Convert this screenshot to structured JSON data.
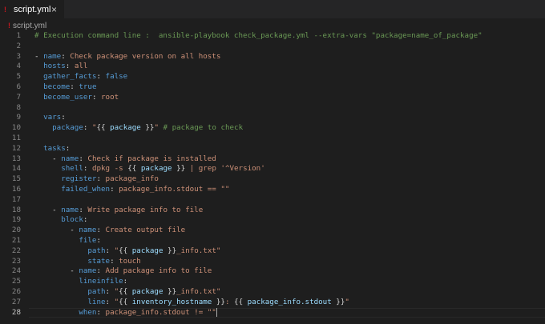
{
  "tab": {
    "icon": "!",
    "label": "script.yml",
    "close": "×"
  },
  "breadcrumb": {
    "icon": "!",
    "label": "script.yml"
  },
  "colors": {
    "key": "#569cd6",
    "string": "#ce9178",
    "comment": "#6a9955",
    "keyword": "#569cd6",
    "plain": "#d4d4d4",
    "brace": "#ffd700",
    "var": "#9cdcfe"
  },
  "active_line": 28,
  "lines": [
    [
      {
        "t": "# Execution command line :  ansible-playbook check_package.yml --extra-vars \"package=name_of_package\"",
        "c": "comment"
      }
    ],
    [],
    [
      {
        "t": "- ",
        "c": "plain"
      },
      {
        "t": "name",
        "c": "key"
      },
      {
        "t": ": ",
        "c": "plain"
      },
      {
        "t": "Check package version on all hosts",
        "c": "string"
      }
    ],
    [
      {
        "t": "  ",
        "c": "plain"
      },
      {
        "t": "hosts",
        "c": "key"
      },
      {
        "t": ": ",
        "c": "plain"
      },
      {
        "t": "all",
        "c": "string"
      }
    ],
    [
      {
        "t": "  ",
        "c": "plain"
      },
      {
        "t": "gather_facts",
        "c": "key"
      },
      {
        "t": ": ",
        "c": "plain"
      },
      {
        "t": "false",
        "c": "keyword"
      }
    ],
    [
      {
        "t": "  ",
        "c": "plain"
      },
      {
        "t": "become",
        "c": "key"
      },
      {
        "t": ": ",
        "c": "plain"
      },
      {
        "t": "true",
        "c": "keyword"
      }
    ],
    [
      {
        "t": "  ",
        "c": "plain"
      },
      {
        "t": "become_user",
        "c": "key"
      },
      {
        "t": ": ",
        "c": "plain"
      },
      {
        "t": "root",
        "c": "string"
      }
    ],
    [],
    [
      {
        "t": "  ",
        "c": "plain"
      },
      {
        "t": "vars",
        "c": "key"
      },
      {
        "t": ":",
        "c": "plain"
      }
    ],
    [
      {
        "t": "    ",
        "c": "plain"
      },
      {
        "t": "package",
        "c": "key"
      },
      {
        "t": ": ",
        "c": "plain"
      },
      {
        "t": "\"",
        "c": "string"
      },
      {
        "t": "{{",
        "c": "plain"
      },
      {
        "t": " package ",
        "c": "var"
      },
      {
        "t": "}}",
        "c": "plain"
      },
      {
        "t": "\"",
        "c": "string"
      },
      {
        "t": " # package to check",
        "c": "comment"
      }
    ],
    [],
    [
      {
        "t": "  ",
        "c": "plain"
      },
      {
        "t": "tasks",
        "c": "key"
      },
      {
        "t": ":",
        "c": "plain"
      }
    ],
    [
      {
        "t": "    - ",
        "c": "plain"
      },
      {
        "t": "name",
        "c": "key"
      },
      {
        "t": ": ",
        "c": "plain"
      },
      {
        "t": "Check if package is installed",
        "c": "string"
      }
    ],
    [
      {
        "t": "      ",
        "c": "plain"
      },
      {
        "t": "shell",
        "c": "key"
      },
      {
        "t": ": ",
        "c": "plain"
      },
      {
        "t": "dpkg -s ",
        "c": "string"
      },
      {
        "t": "{{",
        "c": "plain"
      },
      {
        "t": " package ",
        "c": "var"
      },
      {
        "t": "}}",
        "c": "plain"
      },
      {
        "t": " | grep '^Version'",
        "c": "string"
      }
    ],
    [
      {
        "t": "      ",
        "c": "plain"
      },
      {
        "t": "register",
        "c": "key"
      },
      {
        "t": ": ",
        "c": "plain"
      },
      {
        "t": "package_info",
        "c": "string"
      }
    ],
    [
      {
        "t": "      ",
        "c": "plain"
      },
      {
        "t": "failed_when",
        "c": "key"
      },
      {
        "t": ": ",
        "c": "plain"
      },
      {
        "t": "package_info.stdout == \"\"",
        "c": "string"
      }
    ],
    [],
    [
      {
        "t": "    - ",
        "c": "plain"
      },
      {
        "t": "name",
        "c": "key"
      },
      {
        "t": ": ",
        "c": "plain"
      },
      {
        "t": "Write package info to file",
        "c": "string"
      }
    ],
    [
      {
        "t": "      ",
        "c": "plain"
      },
      {
        "t": "block",
        "c": "key"
      },
      {
        "t": ":",
        "c": "plain"
      }
    ],
    [
      {
        "t": "        - ",
        "c": "plain"
      },
      {
        "t": "name",
        "c": "key"
      },
      {
        "t": ": ",
        "c": "plain"
      },
      {
        "t": "Create output file",
        "c": "string"
      }
    ],
    [
      {
        "t": "          ",
        "c": "plain"
      },
      {
        "t": "file",
        "c": "key"
      },
      {
        "t": ":",
        "c": "plain"
      }
    ],
    [
      {
        "t": "            ",
        "c": "plain"
      },
      {
        "t": "path",
        "c": "key"
      },
      {
        "t": ": ",
        "c": "plain"
      },
      {
        "t": "\"",
        "c": "string"
      },
      {
        "t": "{{",
        "c": "plain"
      },
      {
        "t": " package ",
        "c": "var"
      },
      {
        "t": "}}",
        "c": "plain"
      },
      {
        "t": "_info.txt\"",
        "c": "string"
      }
    ],
    [
      {
        "t": "            ",
        "c": "plain"
      },
      {
        "t": "state",
        "c": "key"
      },
      {
        "t": ": ",
        "c": "plain"
      },
      {
        "t": "touch",
        "c": "string"
      }
    ],
    [
      {
        "t": "        - ",
        "c": "plain"
      },
      {
        "t": "name",
        "c": "key"
      },
      {
        "t": ": ",
        "c": "plain"
      },
      {
        "t": "Add package info to file",
        "c": "string"
      }
    ],
    [
      {
        "t": "          ",
        "c": "plain"
      },
      {
        "t": "lineinfile",
        "c": "key"
      },
      {
        "t": ":",
        "c": "plain"
      }
    ],
    [
      {
        "t": "            ",
        "c": "plain"
      },
      {
        "t": "path",
        "c": "key"
      },
      {
        "t": ": ",
        "c": "plain"
      },
      {
        "t": "\"",
        "c": "string"
      },
      {
        "t": "{{",
        "c": "plain"
      },
      {
        "t": " package ",
        "c": "var"
      },
      {
        "t": "}}",
        "c": "plain"
      },
      {
        "t": "_info.txt\"",
        "c": "string"
      }
    ],
    [
      {
        "t": "            ",
        "c": "plain"
      },
      {
        "t": "line",
        "c": "key"
      },
      {
        "t": ": ",
        "c": "plain"
      },
      {
        "t": "\"",
        "c": "string"
      },
      {
        "t": "{{",
        "c": "plain"
      },
      {
        "t": " inventory_hostname ",
        "c": "var"
      },
      {
        "t": "}}",
        "c": "plain"
      },
      {
        "t": ": ",
        "c": "string"
      },
      {
        "t": "{{",
        "c": "plain"
      },
      {
        "t": " package_info.stdout ",
        "c": "var"
      },
      {
        "t": "}}",
        "c": "plain"
      },
      {
        "t": "\"",
        "c": "string"
      }
    ],
    [
      {
        "t": "          ",
        "c": "plain"
      },
      {
        "t": "when",
        "c": "key"
      },
      {
        "t": ": ",
        "c": "plain"
      },
      {
        "t": "package_info.stdout != \"\"",
        "c": "string"
      }
    ]
  ]
}
